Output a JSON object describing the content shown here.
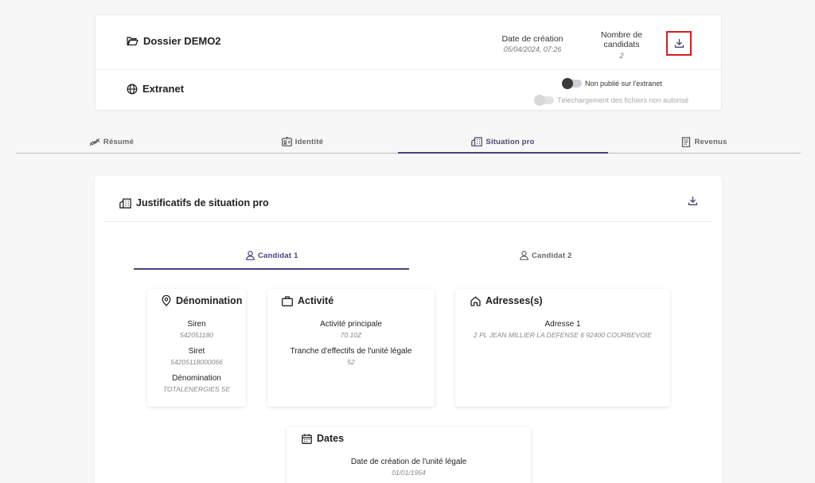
{
  "header": {
    "dossier_title": "Dossier DEMO2",
    "creation_label": "Date de création",
    "creation_value": "05/04/2024, 07:26",
    "candidates_label_line1": "Nombre de",
    "candidates_label_line2": "candidats",
    "candidates_value": "2",
    "extranet_title": "Extranet",
    "toggle_published_label": "Non publié sur l'extranet",
    "toggle_download_label": "Téléchargement des fichiers non autorisé"
  },
  "tabs": [
    {
      "label": "Résumé",
      "icon": "chart-line-icon"
    },
    {
      "label": "Identité",
      "icon": "id-card-icon"
    },
    {
      "label": "Situation pro",
      "icon": "buildings-icon",
      "active": true
    },
    {
      "label": "Revenus",
      "icon": "receipt-icon"
    }
  ],
  "section": {
    "title": "Justificatifs de situation pro"
  },
  "candidate_tabs": [
    {
      "label": "Candidat 1",
      "active": true
    },
    {
      "label": "Candidat 2",
      "active": false
    }
  ],
  "cards": {
    "denomination": {
      "title": "Dénomination",
      "siren_label": "Siren",
      "siren_value": "542051180",
      "siret_label": "Siret",
      "siret_value": "54205118000066",
      "denom_label": "Dénomination",
      "denom_value": "TOTALENERGIES SE"
    },
    "activite": {
      "title": "Activité",
      "principale_label": "Activité principale",
      "principale_value": "70.10Z",
      "tranche_label": "Tranche d'effectifs de l'unité légale",
      "tranche_value": "52"
    },
    "adresses": {
      "title": "Adresses(s)",
      "adresse_label": "Adresse 1",
      "adresse_value": "2 PL JEAN MILLIER LA DEFENSE 6 92400 COURBEVOIE"
    },
    "dates": {
      "title": "Dates",
      "creation_label": "Date de création de l'unité légale",
      "creation_value": "01/01/1954"
    }
  },
  "colors": {
    "accent": "#4d3f7a",
    "highlight": "#d32020"
  }
}
